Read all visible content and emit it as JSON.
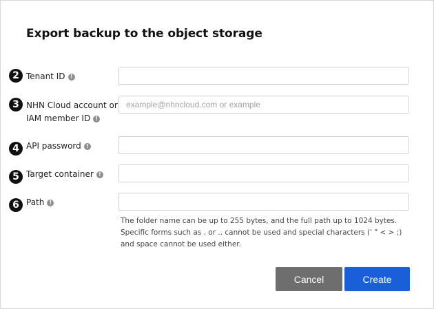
{
  "dialog": {
    "title": "Export backup to the object storage"
  },
  "fields": [
    {
      "number": "2",
      "label": "Tenant ID",
      "value": "",
      "placeholder": ""
    },
    {
      "number": "3",
      "label_line1": "NHN Cloud account or",
      "label_line2": "IAM member ID",
      "value": "",
      "placeholder": "example@nhncloud.com or example"
    },
    {
      "number": "4",
      "label": "API password",
      "value": "",
      "placeholder": ""
    },
    {
      "number": "5",
      "label": "Target container",
      "value": "",
      "placeholder": ""
    },
    {
      "number": "6",
      "label": "Path",
      "value": "",
      "placeholder": ""
    }
  ],
  "path_help": "The folder name can be up to 255 bytes, and the full path up to 1024 bytes. Specific forms such as . or .. cannot be used and special characters (' \" < > ;) and space cannot be used either.",
  "info_glyph": "!",
  "buttons": {
    "cancel": "Cancel",
    "create": "Create"
  },
  "colors": {
    "create_button": "#1a5fd9",
    "cancel_button": "#6e6e6e",
    "step_marker": "#111111",
    "info_icon": "#8f8f8f"
  },
  "icons": {
    "info": "info-icon"
  }
}
